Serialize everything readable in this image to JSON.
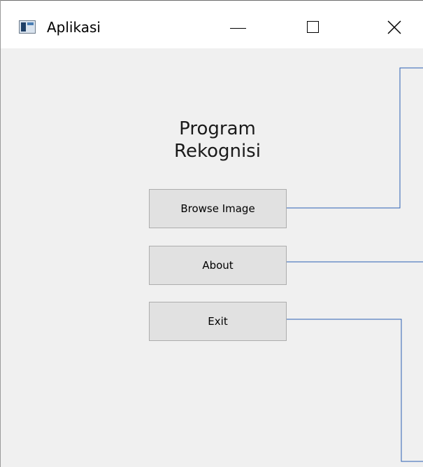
{
  "window": {
    "title": "Aplikasi",
    "icon": "app-window-icon",
    "controls": [
      "minimize-icon",
      "maximize-icon",
      "close-icon"
    ]
  },
  "main": {
    "heading": "Program\nRekognisi",
    "buttons": {
      "browse": "Browse Image",
      "about": "About",
      "exit": "Exit"
    }
  },
  "colors": {
    "background": "#f0f0f0",
    "button_face": "#e1e1e1",
    "button_border": "#adadad",
    "connector_line": "#2b5fb4"
  }
}
